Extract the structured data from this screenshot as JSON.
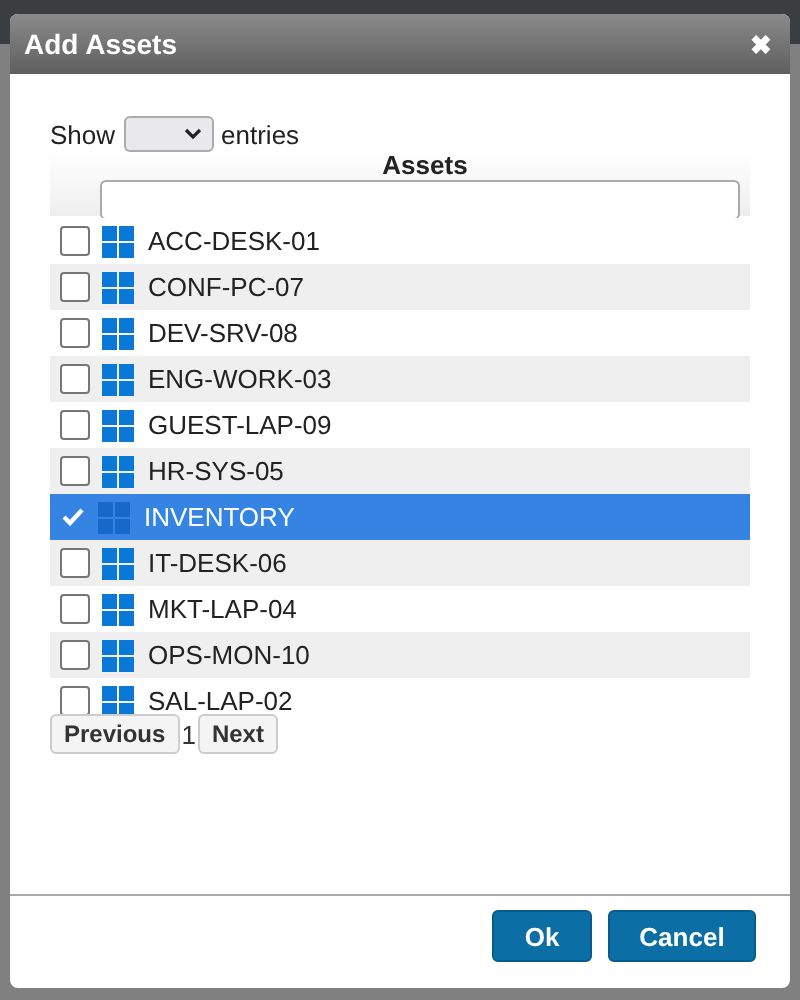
{
  "dialog": {
    "title": "Add Assets",
    "close_symbol": "✖"
  },
  "length_menu": {
    "before": "Show",
    "after": "entries"
  },
  "table": {
    "column": "Assets",
    "rows": [
      {
        "name": "ACC-DESK-01",
        "checked": false,
        "selected": false
      },
      {
        "name": "CONF-PC-07",
        "checked": false,
        "selected": false
      },
      {
        "name": "DEV-SRV-08",
        "checked": false,
        "selected": false
      },
      {
        "name": "ENG-WORK-03",
        "checked": false,
        "selected": false
      },
      {
        "name": "GUEST-LAP-09",
        "checked": false,
        "selected": false
      },
      {
        "name": "HR-SYS-05",
        "checked": false,
        "selected": false
      },
      {
        "name": "INVENTORY",
        "checked": true,
        "selected": true
      },
      {
        "name": "IT-DESK-06",
        "checked": false,
        "selected": false
      },
      {
        "name": "MKT-LAP-04",
        "checked": false,
        "selected": false
      },
      {
        "name": "OPS-MON-10",
        "checked": false,
        "selected": false
      },
      {
        "name": "SAL-LAP-02",
        "checked": false,
        "selected": false
      }
    ]
  },
  "pagination": {
    "previous": "Previous",
    "page": "1",
    "next": "Next"
  },
  "buttons": [
    "Ok",
    "Cancel"
  ]
}
